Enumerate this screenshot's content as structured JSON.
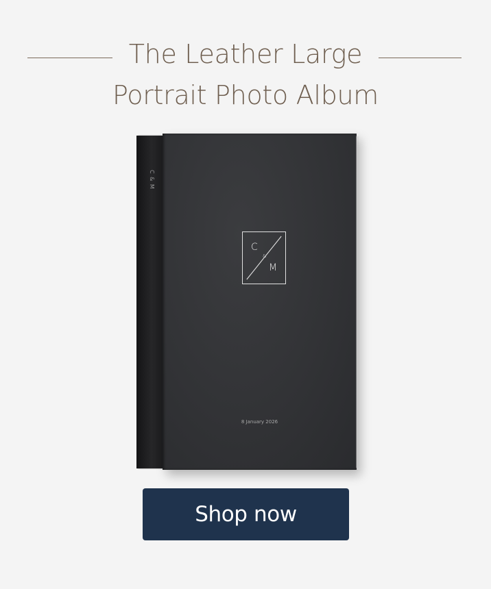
{
  "heading": {
    "line1": "The Leather Large",
    "line2": "Portrait Photo Album"
  },
  "album": {
    "spine_monogram": "C & M",
    "monogram_left": "C",
    "monogram_amp": "&",
    "monogram_right": "M",
    "cover_date": "8 January 2026",
    "cover_color": "#323336"
  },
  "cta": {
    "label": "Shop now",
    "color": "#1f334d"
  }
}
